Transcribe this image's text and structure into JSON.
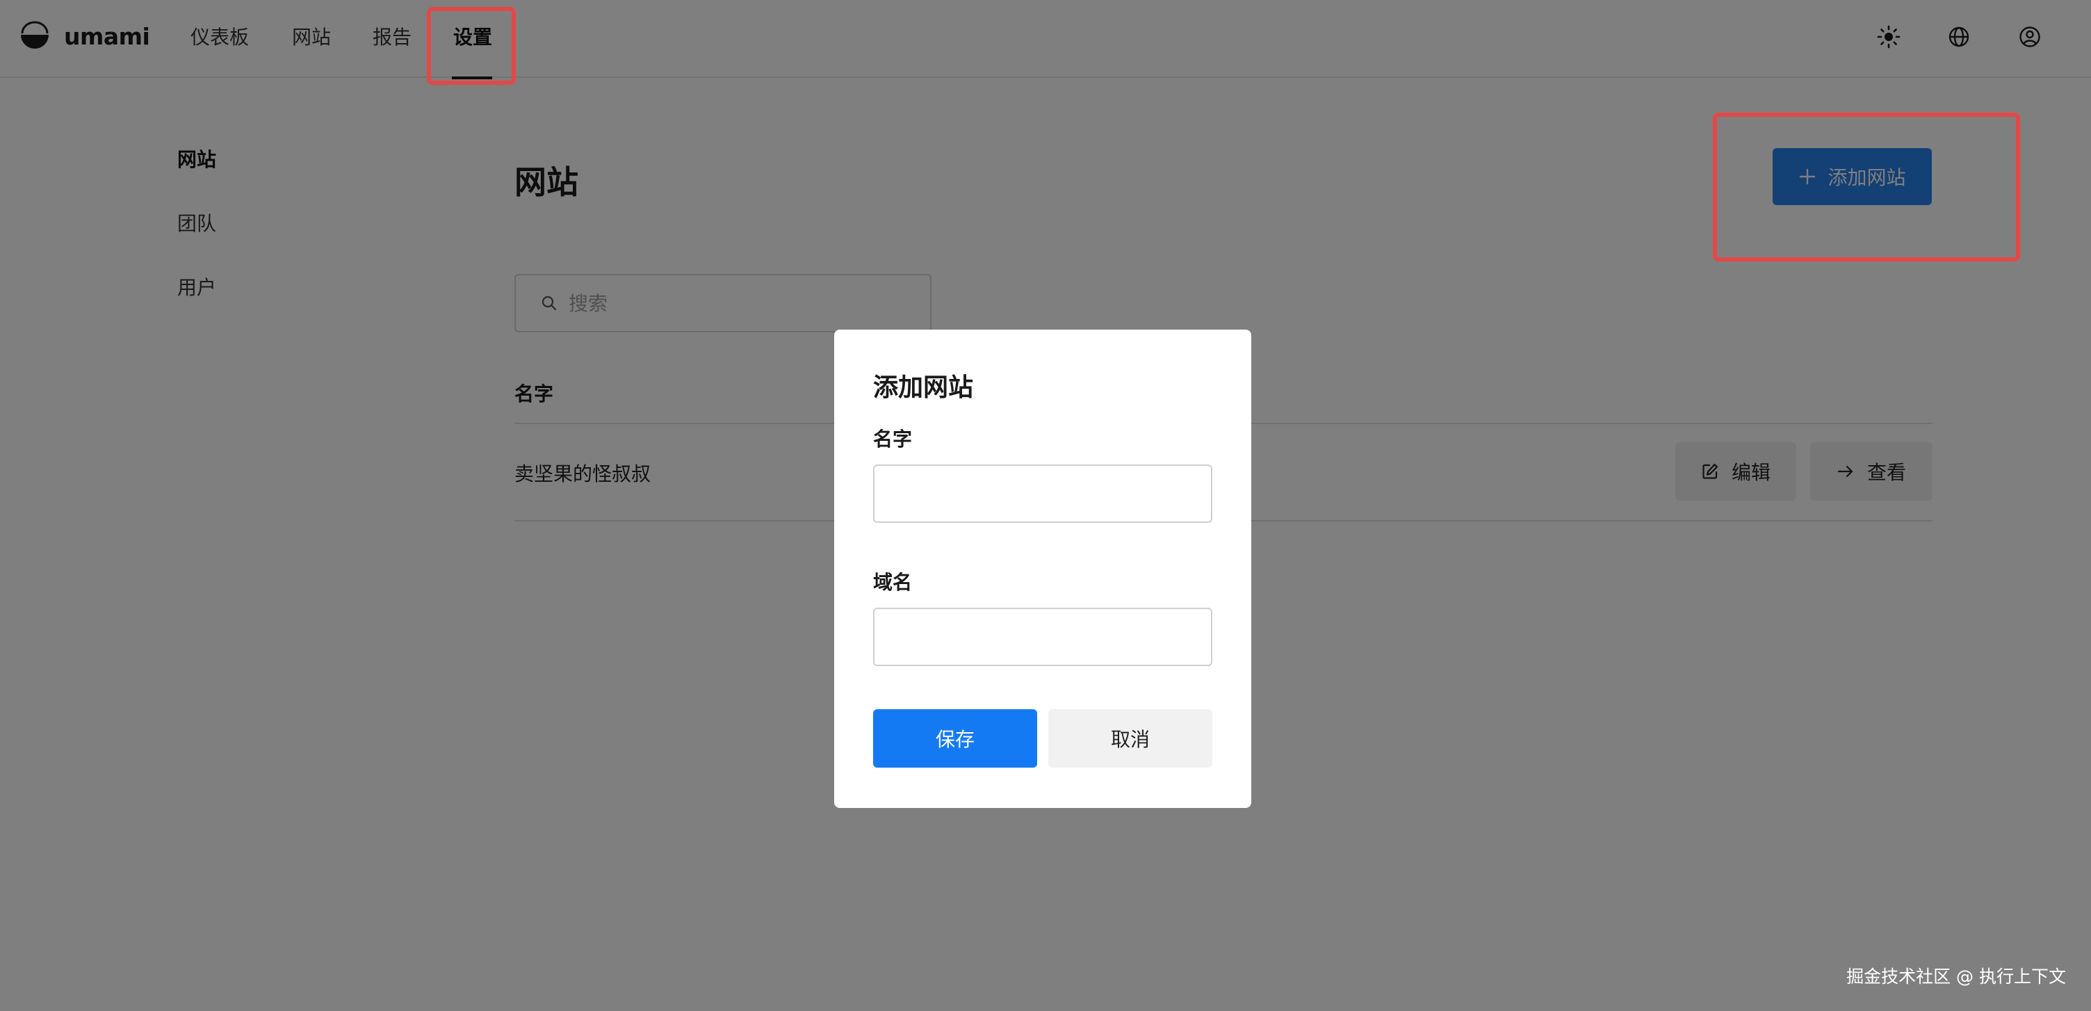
{
  "app": {
    "name": "umami",
    "logo_icon": "umami-logo-icon"
  },
  "nav": {
    "items": [
      {
        "label": "仪表板"
      },
      {
        "label": "网站"
      },
      {
        "label": "报告"
      },
      {
        "label": "设置",
        "active": true
      }
    ]
  },
  "header_icons": [
    "sun-icon",
    "globe-icon",
    "user-circle-icon"
  ],
  "sidebar": {
    "items": [
      {
        "label": "网站",
        "active": true
      },
      {
        "label": "团队"
      },
      {
        "label": "用户"
      }
    ]
  },
  "main": {
    "title": "网站",
    "add_button_label": "添加网站",
    "search_placeholder": "搜索",
    "table": {
      "column_name": "名字",
      "rows": [
        {
          "name": "卖坚果的怪叔叔",
          "edit_label": "编辑",
          "view_label": "查看"
        }
      ]
    }
  },
  "modal": {
    "title": "添加网站",
    "name_label": "名字",
    "name_value": "",
    "domain_label": "域名",
    "domain_value": "",
    "save_label": "保存",
    "cancel_label": "取消"
  },
  "watermark": "掘金技术社区 @ 执行上下文",
  "colors": {
    "accent": "#147af3",
    "highlight": "#e34848",
    "overlay": "rgba(0,0,0,0.5)"
  }
}
